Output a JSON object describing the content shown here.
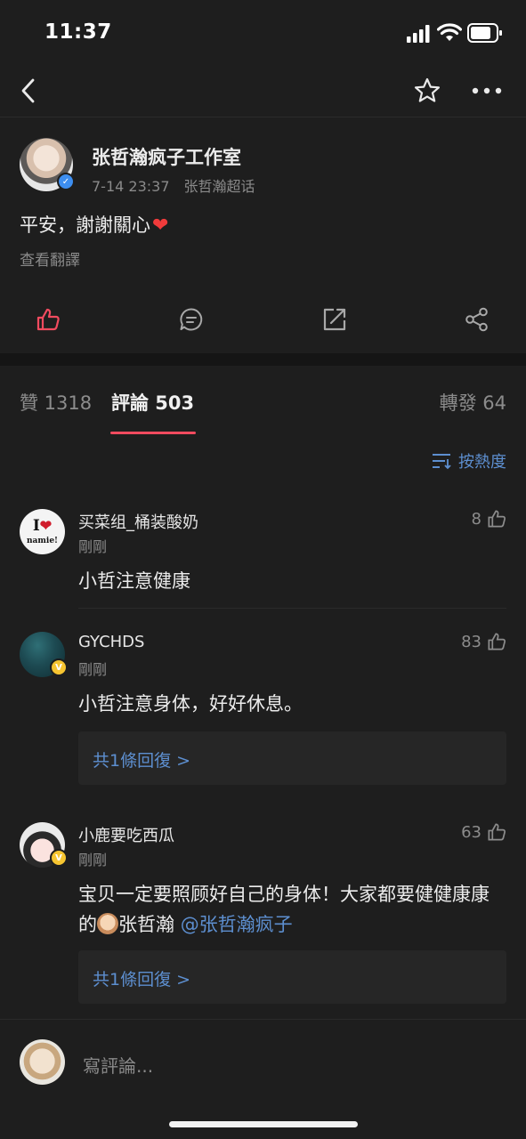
{
  "status": {
    "time": "11:37"
  },
  "post": {
    "author": "张哲瀚疯子工作室",
    "date": "7-14 23:37",
    "source": "张哲瀚超话",
    "text": "平安，謝謝關心",
    "translate": "查看翻譯"
  },
  "tabs": [
    {
      "label": "贊 1318"
    },
    {
      "label": "評論 503"
    },
    {
      "label": "轉發 64"
    }
  ],
  "sort_label": "按熱度",
  "comments": [
    {
      "name": "买菜组_桶装酸奶",
      "time": "剛剛",
      "text": "小哲注意健康",
      "likes": "8"
    },
    {
      "name": "GYCHDS",
      "time": "剛剛",
      "text": "小哲注意身体，好好休息。",
      "likes": "83",
      "reply": "共1條回復 >"
    },
    {
      "name": "小鹿要吃西瓜",
      "time": "剛剛",
      "text_pre": "宝贝一定要照顾好自己的身体！大家都要健健康康的",
      "text_mid": "张哲瀚",
      "mention": "@张哲瀚疯子",
      "likes": "63",
      "reply": "共1條回復 >"
    }
  ],
  "avatar_text": {
    "line1": "I",
    "line2": "namie!"
  },
  "input_placeholder": "寫評論...",
  "colors": {
    "accent": "#f24b5f",
    "link": "#5d8fd0",
    "verified_blue": "#3d8ef0",
    "verified_gold": "#f7c531"
  }
}
